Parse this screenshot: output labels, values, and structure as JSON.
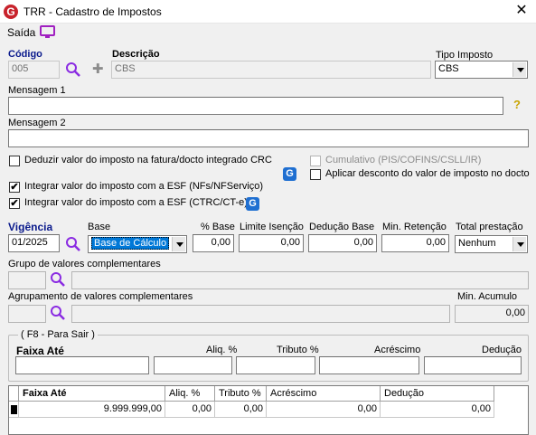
{
  "window": {
    "title": "TRR - Cadastro de Impostos",
    "logo": "G"
  },
  "toolbar": {
    "saida": "Saída"
  },
  "form": {
    "codigo_label": "Código",
    "codigo_value": "005",
    "descricao_label": "Descrição",
    "descricao_value": "CBS",
    "tipo_imposto_label": "Tipo Imposto",
    "tipo_imposto_value": "CBS",
    "mensagem1_label": "Mensagem 1",
    "mensagem1_value": "",
    "help_glyph": "?",
    "mensagem2_label": "Mensagem 2",
    "mensagem2_value": ""
  },
  "checkboxes": {
    "deduzir": {
      "label": "Deduzir valor do imposto na fatura/docto integrado CRC",
      "checked": false
    },
    "cumulativo": {
      "label": "Cumulativo (PIS/COFINS/CSLL/IR)",
      "checked": false
    },
    "aplicar_desconto": {
      "label": "Aplicar desconto do valor de imposto no docto",
      "checked": false
    },
    "integrar_nfs": {
      "label": "Integrar valor do imposto com a ESF (NFs/NFServiço)",
      "checked": true
    },
    "integrar_ctrc": {
      "label": "Integrar valor do imposto com a ESF (CTRC/CT-e)",
      "checked": true
    },
    "check_glyph": "✔",
    "g_glyph": "G"
  },
  "vigencia": {
    "vigencia_label": "Vigência",
    "vigencia_value": "01/2025",
    "base_label": "Base",
    "base_value": "Base de Cálculo",
    "pct_base_label": "% Base",
    "pct_base_value": "0,00",
    "limite_label": "Limite Isenção",
    "limite_value": "0,00",
    "deducao_base_label": "Dedução Base",
    "deducao_base_value": "0,00",
    "min_retencao_label": "Min. Retenção",
    "min_retencao_value": "0,00",
    "total_prestacao_label": "Total prestação",
    "total_prestacao_value": "Nenhum"
  },
  "complementares": {
    "grupo_label": "Grupo de valores complementares",
    "agrupamento_label": "Agrupamento de valores complementares",
    "min_acumulo_label": "Min. Acumulo",
    "min_acumulo_value": "0,00"
  },
  "faixa": {
    "legend": "( F8 - Para Sair )",
    "faixa_ate_label": "Faixa Até",
    "aliq_label": "Aliq. %",
    "tributo_label": "Tributo %",
    "acrescimo_label": "Acréscimo",
    "deducao_label": "Dedução"
  },
  "grid": {
    "headers": [
      "Faixa Até",
      "Aliq. %",
      "Tributo %",
      "Acréscimo",
      "Dedução"
    ],
    "rows": [
      [
        "9.999.999,00",
        "0,00",
        "0,00",
        "0,00",
        "0,00"
      ]
    ]
  },
  "colors": {
    "accent_blue": "#0a1a8c",
    "logo_red": "#c8232c",
    "select_highlight": "#0078d7",
    "monitor_icon": "#a020c0",
    "search_icon": "#8a2be2"
  }
}
